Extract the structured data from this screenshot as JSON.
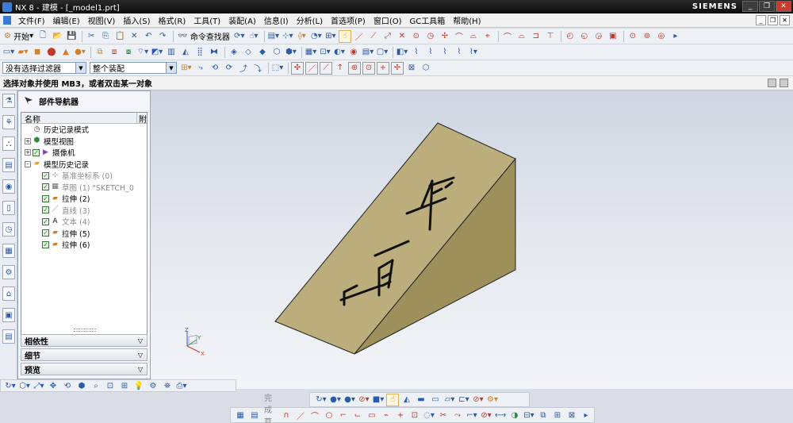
{
  "window": {
    "title": "NX 8 - 建模 - [_model1.prt]",
    "brand": "SIEMENS",
    "buttons": [
      "_",
      "❐",
      "✕"
    ],
    "mdi_buttons": [
      "_",
      "❐",
      "✕"
    ]
  },
  "menu": {
    "items": [
      "文件(F)",
      "编辑(E)",
      "视图(V)",
      "插入(S)",
      "格式(R)",
      "工具(T)",
      "装配(A)",
      "信息(I)",
      "分析(L)",
      "首选项(P)",
      "窗口(O)",
      "GC工具箱",
      "帮助(H)"
    ]
  },
  "toolbar": {
    "start_label": "开始",
    "command_finder_label": "命令查找器"
  },
  "selection": {
    "filter_value": "没有选择过滤器",
    "scope_value": "整个装配"
  },
  "cue_line": {
    "text": "选择对象并使用 MB3，或者双击某一对象"
  },
  "navigator": {
    "title": "部件导航器",
    "col_name": "名称",
    "col_extra": "附",
    "tree": [
      {
        "label": "历史记录模式",
        "level": 0,
        "expand": "",
        "check": false,
        "icon": "clock-icon",
        "dim": false
      },
      {
        "label": "模型视图",
        "level": 0,
        "expand": "+",
        "check": false,
        "icon": "model-views-icon",
        "dim": false
      },
      {
        "label": "摄像机",
        "level": 0,
        "expand": "+",
        "check": true,
        "icon": "camera-icon",
        "dim": false
      },
      {
        "label": "模型历史记录",
        "level": 0,
        "expand": "-",
        "check": false,
        "icon": "folder-icon",
        "dim": false
      },
      {
        "label": "基准坐标系 (0)",
        "level": 1,
        "expand": "",
        "check": true,
        "icon": "datum-csys-icon",
        "dim": true
      },
      {
        "label": "草图 (1) \"SKETCH_0",
        "level": 1,
        "expand": "",
        "check": true,
        "icon": "sketch-icon",
        "dim": true
      },
      {
        "label": "拉伸 (2)",
        "level": 1,
        "expand": "",
        "check": true,
        "icon": "extrude-icon",
        "dim": false
      },
      {
        "label": "直线 (3)",
        "level": 1,
        "expand": "",
        "check": true,
        "icon": "line-icon",
        "dim": true
      },
      {
        "label": "文本 (4)",
        "level": 1,
        "expand": "",
        "check": true,
        "icon": "text-icon",
        "dim": true
      },
      {
        "label": "拉伸 (5)",
        "level": 1,
        "expand": "",
        "check": true,
        "icon": "extrude-icon",
        "dim": false
      },
      {
        "label": "拉伸 (6)",
        "level": 1,
        "expand": "",
        "check": true,
        "icon": "extrude-icon",
        "dim": false
      }
    ],
    "panels": [
      "相依性",
      "细节",
      "预览"
    ]
  },
  "model": {
    "engraved_text": [
      "平",
      "面"
    ],
    "top_face_color": "#bbae7c",
    "side_face_color": "#9e905a",
    "end_face_color": "#8a7d48"
  },
  "triad": {
    "x_label": "X",
    "y_label": "Y",
    "z_label": "Z"
  },
  "bottom_toolbar": {
    "sketch_finish_label": "完成草图"
  }
}
